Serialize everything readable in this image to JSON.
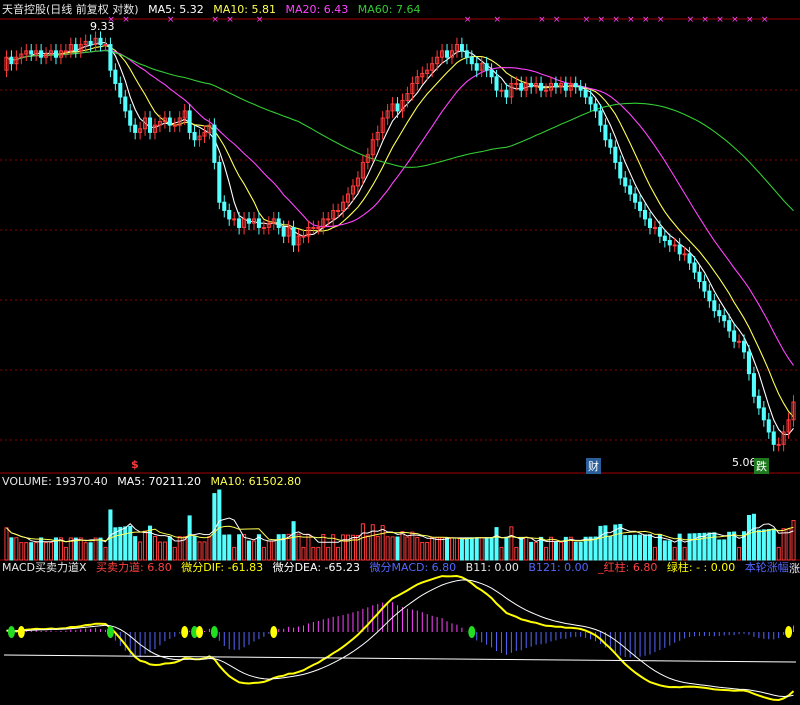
{
  "header": {
    "stock_label": "天音控股(日线 前复权 对数)",
    "ma5_label": "MA5: 5.32",
    "ma10_label": "MA10: 5.81",
    "ma20_label": "MA20: 6.43",
    "ma60_label": "MA60: 7.64"
  },
  "volume_panel": {
    "volume_label": "VOLUME: 19370.40",
    "ma5_label": "MA5: 70211.20",
    "ma10_label": "MA10: 61502.80"
  },
  "macd_panel": {
    "title_label": "MACD买卖力道X",
    "force_label": "买卖力道: 6.80",
    "dif_label": "微分DIF: -61.83",
    "dea_label": "微分DEA: -65.23",
    "macd_label": "微分MACD: 6.80",
    "b11_label": "B11: 0.00",
    "b121_label": "B121: 0.00",
    "red_label": "_红柱: 6.80",
    "green_label": "绿柱: - : 0.00",
    "yesterday_label": "本轮涨幅: -",
    "trail_label": "涨"
  },
  "markers": {
    "high_label": "9.33",
    "low_label": "5.06",
    "s_marker": "$",
    "cai_marker": "财",
    "die_marker": "跌"
  },
  "colors": {
    "background": "#000000",
    "up": "#ff3b3b",
    "down": "#54ffff",
    "ma5": "#ffffff",
    "ma10": "#ffff55",
    "ma20": "#ff44ff",
    "ma60": "#33cc33",
    "dif": "#ffff00",
    "dea": "#ffffff",
    "hist_pos": "#ff44ff",
    "hist_neg": "#5566ff",
    "signal_green": "#22dd22",
    "signal_yellow": "#ffff00",
    "grid": "#8b0000",
    "separator": "#a00000",
    "cross": "#ff44ff"
  },
  "chart_data": {
    "type": "candlestick",
    "scale": "log",
    "x": [
      1,
      2,
      3,
      4,
      5,
      6,
      7,
      8,
      9,
      10,
      11,
      12,
      13,
      14,
      15,
      16,
      17,
      18,
      19,
      20,
      21,
      22,
      23,
      24,
      25,
      26,
      27,
      28,
      29,
      30,
      31,
      32,
      33,
      34,
      35,
      36,
      37,
      38,
      39,
      40,
      41,
      42,
      43,
      44,
      45,
      46,
      47,
      48,
      49,
      50,
      51,
      52,
      53,
      54,
      55,
      56,
      57,
      58,
      59,
      60,
      61,
      62,
      63,
      64,
      65,
      66,
      67,
      68,
      69,
      70,
      71,
      72,
      73,
      74,
      75,
      76,
      77,
      78,
      79,
      80,
      81,
      82,
      83,
      84,
      85,
      86,
      87,
      88,
      89,
      90,
      91,
      92,
      93,
      94,
      95,
      96,
      97,
      98,
      99,
      100,
      101,
      102,
      103,
      104,
      105,
      106,
      107,
      108,
      109,
      110,
      111,
      112,
      113,
      114,
      115,
      116,
      117,
      118,
      119,
      120,
      121,
      122,
      123,
      124,
      125,
      126,
      127,
      128,
      129,
      130,
      131,
      132,
      133,
      134,
      135,
      136,
      137,
      138,
      139,
      140,
      141,
      142,
      143,
      144,
      145,
      146,
      147,
      148,
      149,
      150,
      151,
      152,
      153,
      154,
      155,
      156,
      157,
      158,
      159,
      160
    ],
    "open": [
      8.8,
      9.0,
      8.9,
      9.0,
      9.05,
      9.1,
      9.05,
      9.1,
      9.0,
      9.05,
      9.1,
      9.0,
      9.1,
      9.1,
      9.2,
      9.1,
      9.2,
      9.25,
      9.2,
      9.3,
      9.2,
      9.2,
      8.8,
      8.6,
      8.4,
      8.2,
      8.0,
      7.9,
      7.95,
      8.1,
      7.9,
      8.0,
      8.05,
      8.1,
      8.0,
      8.0,
      8.1,
      8.2,
      7.9,
      7.8,
      7.85,
      7.9,
      8.0,
      7.5,
      7.0,
      6.9,
      6.8,
      6.8,
      6.7,
      6.8,
      6.75,
      6.8,
      6.7,
      6.7,
      6.75,
      6.8,
      6.7,
      6.6,
      6.7,
      6.5,
      6.6,
      6.6,
      6.7,
      6.7,
      6.7,
      6.8,
      6.8,
      6.9,
      6.9,
      7.0,
      7.1,
      7.2,
      7.3,
      7.5,
      7.6,
      7.8,
      7.9,
      8.1,
      8.2,
      8.3,
      8.2,
      8.35,
      8.45,
      8.6,
      8.7,
      8.75,
      8.8,
      8.9,
      9.0,
      9.1,
      9.0,
      9.1,
      9.2,
      9.1,
      9.0,
      8.9,
      8.8,
      8.9,
      8.8,
      8.7,
      8.5,
      8.5,
      8.4,
      8.6,
      8.6,
      8.5,
      8.6,
      8.55,
      8.6,
      8.5,
      8.5,
      8.6,
      8.55,
      8.6,
      8.5,
      8.6,
      8.55,
      8.5,
      8.4,
      8.3,
      8.2,
      8.0,
      7.8,
      7.7,
      7.5,
      7.3,
      7.2,
      7.1,
      7.0,
      6.9,
      6.8,
      6.7,
      6.7,
      6.6,
      6.55,
      6.5,
      6.5,
      6.4,
      6.4,
      6.3,
      6.2,
      6.1,
      6.0,
      5.9,
      5.8,
      5.75,
      5.7,
      5.6,
      5.5,
      5.5,
      5.4,
      5.2,
      5.0,
      4.9,
      4.8,
      4.7,
      4.6,
      4.6,
      4.7,
      4.8
    ],
    "close": [
      9.0,
      8.9,
      9.0,
      9.05,
      9.1,
      9.05,
      9.1,
      9.0,
      9.05,
      9.1,
      9.0,
      9.1,
      9.1,
      9.2,
      9.1,
      9.2,
      9.25,
      9.2,
      9.3,
      9.2,
      9.2,
      8.8,
      8.6,
      8.4,
      8.2,
      8.0,
      7.9,
      7.95,
      8.1,
      7.9,
      8.0,
      8.05,
      8.1,
      8.0,
      8.0,
      8.1,
      8.2,
      7.9,
      7.8,
      7.85,
      7.9,
      8.0,
      7.5,
      7.0,
      6.9,
      6.8,
      6.8,
      6.7,
      6.8,
      6.75,
      6.8,
      6.7,
      6.7,
      6.75,
      6.8,
      6.7,
      6.6,
      6.7,
      6.5,
      6.6,
      6.6,
      6.7,
      6.7,
      6.7,
      6.8,
      6.8,
      6.9,
      6.9,
      7.0,
      7.1,
      7.2,
      7.3,
      7.5,
      7.6,
      7.8,
      7.9,
      8.1,
      8.2,
      8.3,
      8.2,
      8.35,
      8.45,
      8.6,
      8.7,
      8.75,
      8.8,
      8.9,
      9.0,
      9.1,
      9.0,
      9.1,
      9.2,
      9.1,
      9.0,
      8.9,
      8.8,
      8.9,
      8.8,
      8.7,
      8.5,
      8.5,
      8.4,
      8.6,
      8.6,
      8.5,
      8.6,
      8.55,
      8.6,
      8.5,
      8.5,
      8.6,
      8.55,
      8.6,
      8.5,
      8.6,
      8.55,
      8.5,
      8.4,
      8.3,
      8.2,
      8.0,
      7.8,
      7.7,
      7.5,
      7.3,
      7.2,
      7.1,
      7.0,
      6.9,
      6.8,
      6.7,
      6.7,
      6.6,
      6.55,
      6.5,
      6.5,
      6.4,
      6.4,
      6.3,
      6.2,
      6.1,
      6.0,
      5.9,
      5.8,
      5.75,
      5.7,
      5.6,
      5.5,
      5.5,
      5.4,
      5.2,
      5.0,
      4.9,
      4.8,
      4.7,
      4.6,
      4.6,
      4.7,
      4.8,
      4.95
    ],
    "high_mark": 9.33,
    "low_mark": 5.06,
    "series": [
      {
        "name": "MA5",
        "value": 5.32
      },
      {
        "name": "MA10",
        "value": 5.81
      },
      {
        "name": "MA20",
        "value": 6.43
      },
      {
        "name": "MA60",
        "value": 7.64
      }
    ],
    "volume_last": 19370.4,
    "volume_ma5": 70211.2,
    "volume_ma10": 61502.8,
    "macd_dif": -61.83,
    "macd_dea": -65.23,
    "macd_hist": 6.8
  }
}
